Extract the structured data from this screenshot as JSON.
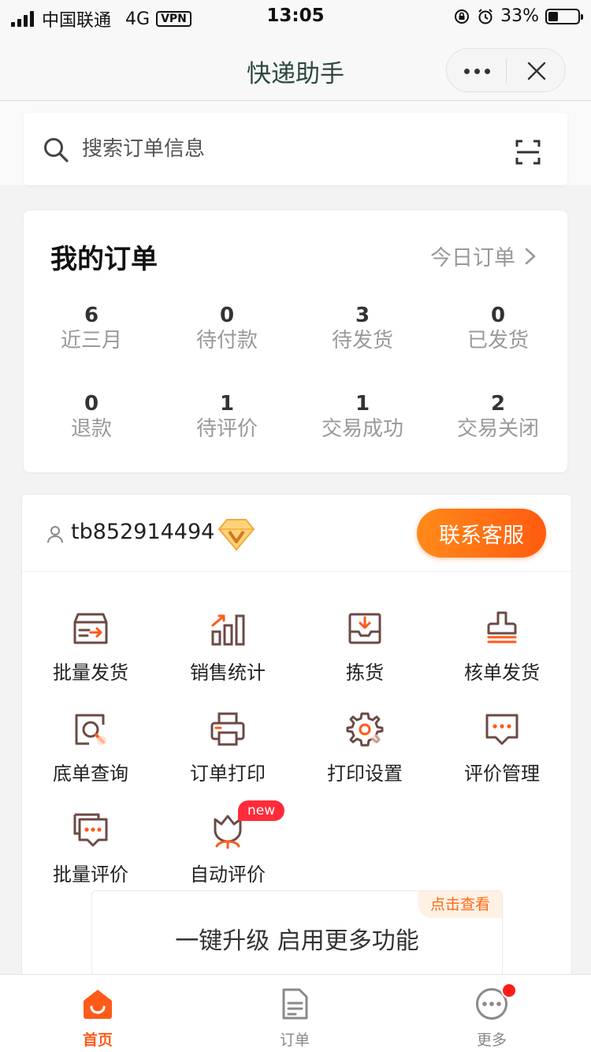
{
  "status_bar": {
    "carrier": "中国联通",
    "network": "4G",
    "vpn": "VPN",
    "time": "13:05",
    "battery": "33%",
    "battery_level": 0.33
  },
  "nav": {
    "title": "快递助手"
  },
  "search": {
    "placeholder": "搜索订单信息"
  },
  "orders": {
    "title": "我的订单",
    "today_link": "今日订单",
    "stats": [
      {
        "count": "6",
        "label": "近三月"
      },
      {
        "count": "0",
        "label": "待付款"
      },
      {
        "count": "3",
        "label": "待发货"
      },
      {
        "count": "0",
        "label": "已发货"
      },
      {
        "count": "0",
        "label": "退款"
      },
      {
        "count": "1",
        "label": "待评价"
      },
      {
        "count": "1",
        "label": "交易成功"
      },
      {
        "count": "2",
        "label": "交易关闭"
      }
    ]
  },
  "account": {
    "name": "tb852914494",
    "contact_button": "联系客服"
  },
  "features": [
    {
      "label": "批量发货",
      "icon": "batch-ship-icon"
    },
    {
      "label": "销售统计",
      "icon": "sales-chart-icon"
    },
    {
      "label": "拣货",
      "icon": "pick-goods-icon"
    },
    {
      "label": "核单发货",
      "icon": "stamp-icon"
    },
    {
      "label": "底单查询",
      "icon": "search-doc-icon"
    },
    {
      "label": "订单打印",
      "icon": "printer-icon"
    },
    {
      "label": "打印设置",
      "icon": "gear-icon"
    },
    {
      "label": "评价管理",
      "icon": "review-chat-icon"
    },
    {
      "label": "批量评价",
      "icon": "batch-review-icon"
    },
    {
      "label": "自动评价",
      "icon": "auto-review-icon",
      "badge": "new"
    }
  ],
  "upgrade": {
    "tag": "点击查看",
    "text": "一键升级 启用更多功能"
  },
  "tabs": [
    {
      "label": "首页",
      "active": true
    },
    {
      "label": "订单",
      "active": false
    },
    {
      "label": "更多",
      "active": false
    }
  ],
  "colors": {
    "accent": "#ff5a1a",
    "icon_dark": "#6b4a45",
    "badge_red": "#ff2b3a"
  }
}
